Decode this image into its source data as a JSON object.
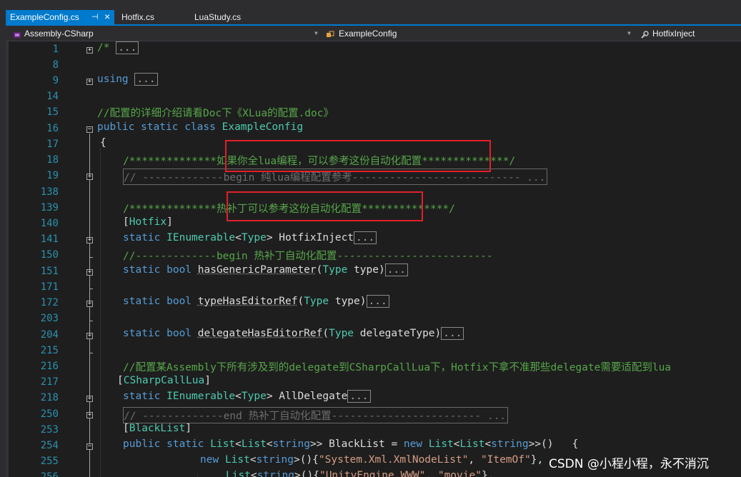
{
  "tabs": [
    {
      "label": "ExampleConfig.cs",
      "pin": "⊣",
      "close": "×"
    },
    {
      "label": "Hotfix.cs"
    },
    {
      "label": "LuaStudy.cs"
    }
  ],
  "nav": {
    "project": "Assembly-CSharp",
    "class": "ExampleConfig",
    "member": "HotfixInject"
  },
  "lines": [
    {
      "n": "1"
    },
    {
      "n": "8"
    },
    {
      "n": "9"
    },
    {
      "n": "14"
    },
    {
      "n": "15"
    },
    {
      "n": "16"
    },
    {
      "n": "17"
    },
    {
      "n": "18"
    },
    {
      "n": "19"
    },
    {
      "n": "138"
    },
    {
      "n": "139"
    },
    {
      "n": "140"
    },
    {
      "n": "141"
    },
    {
      "n": "150"
    },
    {
      "n": "151"
    },
    {
      "n": "171"
    },
    {
      "n": "172"
    },
    {
      "n": "203"
    },
    {
      "n": "204"
    },
    {
      "n": "215"
    },
    {
      "n": "216"
    },
    {
      "n": "217"
    },
    {
      "n": "218"
    },
    {
      "n": "250"
    },
    {
      "n": "253"
    },
    {
      "n": "254"
    },
    {
      "n": "255"
    },
    {
      "n": "256"
    }
  ],
  "code": {
    "l1": "/*",
    "ellipsis": "...",
    "l9_kw": "using",
    "l15": "//配置的详细介绍请看Doc下《XLua的配置.doc》",
    "l16_kw": "public static class",
    "l16_name": "ExampleConfig",
    "l17": "{",
    "l18": "/**************如果你全lua编程，可以参考这份自动化配置**************/",
    "l19": "// -------------begin 纯lua编程配置参考--------------------------- ...",
    "l139": "/**************热补丁可以参考这份自动化配置**************/",
    "l140_a": "[",
    "l140_attr": "Hotfix",
    "l140_b": "]",
    "l141_kw": "static",
    "l141_t1": "IEnumerable",
    "l141_t2": "Type",
    "l141_name": "HotfixInject",
    "l150": "//-------------begin 热补丁自动化配置-------------------------",
    "l151_kw": "static bool",
    "l151_name": "hasGenericParameter",
    "l151_t": "Type",
    "l151_p": "type",
    "l172_name": "typeHasEditorRef",
    "l204_name": "delegateHasEditorRef",
    "l204_p": "delegateType",
    "l216": "//配置某Assembly下所有涉及到的delegate到CSharpCallLua下，Hotfix下拿不准那些delegate需要适配到lua",
    "l217_attr": "CSharpCallLua",
    "l218_name": "AllDelegate",
    "l250": "// -------------end 热补丁自动化配置------------------------ ...",
    "l253_attr": "BlackList",
    "l254_kw": "public static",
    "l254_t1": "List",
    "l254_t2": "string",
    "l254_name": "BlackList",
    "l254_new": "new",
    "l255_s1": "\"System.Xml.XmlNodeList\"",
    "l255_s2": "\"ItemOf\"",
    "l256_s1": "\"UnityEngine.WWW\"",
    "l256_s2": "\"movie\""
  },
  "watermark": "CSDN @小程小程，永不消沉",
  "colors": {
    "background": "#1e1e1e",
    "keyword": "#569cd6",
    "type": "#4ec9b0",
    "comment": "#57a64a",
    "string": "#d69d85",
    "line_number": "#2b91af",
    "tab_active": "#007acc",
    "highlight_box": "#e0202a"
  }
}
